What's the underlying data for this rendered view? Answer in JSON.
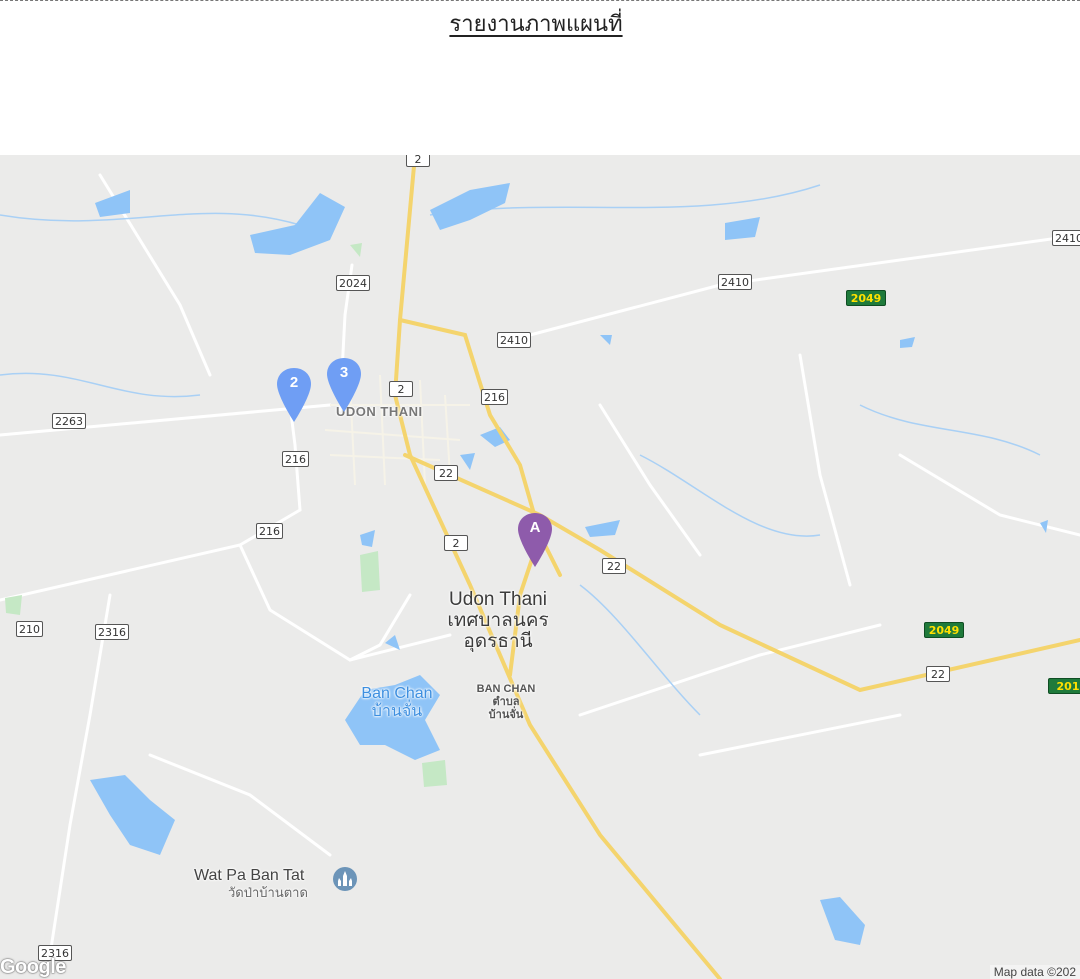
{
  "report": {
    "title": "รายงานภาพแผนที่"
  },
  "map": {
    "city_label_en": "Udon Thani",
    "city_label_th_1": "เทศบาลนคร",
    "city_label_th_2": "อุดรธานี",
    "district_label": "UDON THANI",
    "ban_chan_en": "Ban Chan",
    "ban_chan_th": "บ้านจั่น",
    "ban_chan_small_1": "BAN CHAN",
    "ban_chan_small_2": "ตำบล",
    "ban_chan_small_3": "บ้านจั่น",
    "poi_en": "Wat Pa Ban Tat",
    "poi_th": "วัดป่าบ้านตาด",
    "poi_icon": "temple-icon",
    "attribution": "Map data ©202",
    "google_logo": "Google",
    "route_shields": [
      "2",
      "2024",
      "2410",
      "2410",
      "2049",
      "2410",
      "2",
      "216",
      "2263",
      "216",
      "22",
      "216",
      "2",
      "22",
      "210",
      "2316",
      "2049",
      "22",
      "201",
      "2316",
      "2410"
    ],
    "markers": [
      {
        "label": "2",
        "color": "#6f9ef4",
        "icon": "map-pin-icon"
      },
      {
        "label": "3",
        "color": "#6f9ef4",
        "icon": "map-pin-icon"
      },
      {
        "label": "A",
        "color": "#8e5bab",
        "icon": "map-pin-icon"
      }
    ],
    "colors": {
      "land": "#ebebea",
      "water": "#8fc4f7",
      "highway": "#f4d46d",
      "park": "#c5e8c5"
    }
  }
}
